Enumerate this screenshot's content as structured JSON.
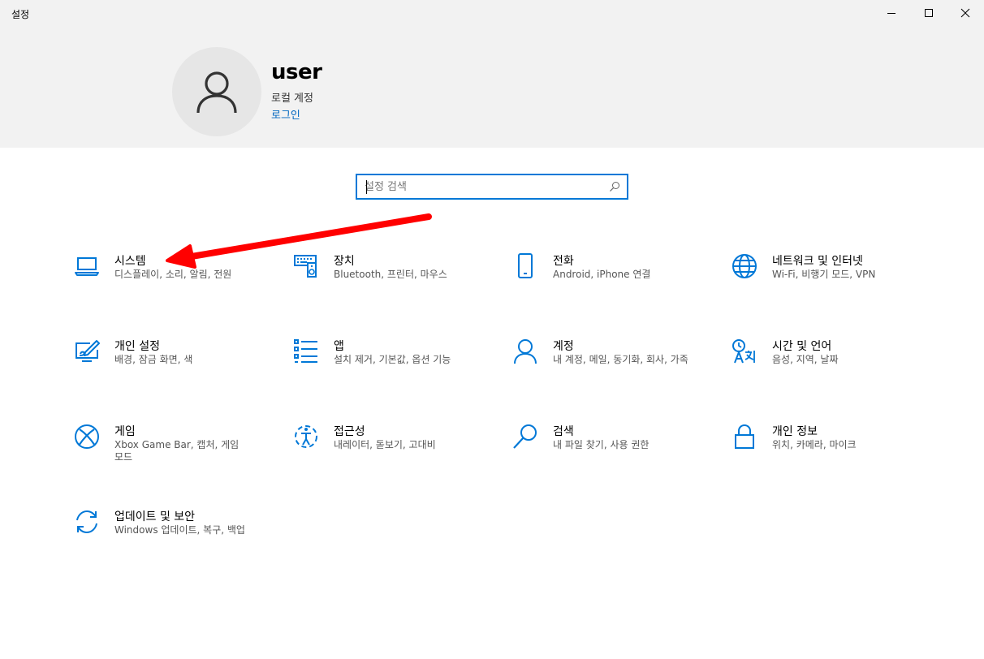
{
  "window": {
    "title": "설정",
    "controls": [
      "minimize-icon",
      "maximize-icon",
      "close-icon"
    ]
  },
  "profile": {
    "username": "user",
    "account_type": "로컬 계정",
    "login_link": "로그인",
    "avatar_icon": "person-icon"
  },
  "search": {
    "placeholder": "설정 검색",
    "value": "",
    "icon": "search-icon"
  },
  "colors": {
    "accent": "#0078d7",
    "link": "#0067c0",
    "header_bg": "#f2f2f2",
    "annotation_arrow": "#ff0000"
  },
  "categories": [
    {
      "icon": "laptop-icon",
      "title": "시스템",
      "desc": "디스플레이, 소리, 알림, 전원"
    },
    {
      "icon": "keyboard-speaker-icon",
      "title": "장치",
      "desc": "Bluetooth, 프린터, 마우스"
    },
    {
      "icon": "phone-icon",
      "title": "전화",
      "desc": "Android, iPhone 연결"
    },
    {
      "icon": "globe-icon",
      "title": "네트워크 및 인터넷",
      "desc": "Wi-Fi, 비행기 모드, VPN"
    },
    {
      "icon": "paint-brush-icon",
      "title": "개인 설정",
      "desc": "배경, 잠금 화면, 색"
    },
    {
      "icon": "app-list-icon",
      "title": "앱",
      "desc": "설치 제거, 기본값, 옵션 기능"
    },
    {
      "icon": "person-icon",
      "title": "계정",
      "desc": "내 계정, 메일, 동기화, 회사, 가족"
    },
    {
      "icon": "language-icon",
      "title": "시간 및 언어",
      "desc": "음성, 지역, 날짜"
    },
    {
      "icon": "xbox-icon",
      "title": "게임",
      "desc": "Xbox Game Bar, 캡처, 게임 모드"
    },
    {
      "icon": "ease-of-access-icon",
      "title": "접근성",
      "desc": "내레이터, 돋보기, 고대비"
    },
    {
      "icon": "search-icon",
      "title": "검색",
      "desc": "내 파일 찾기, 사용 권한"
    },
    {
      "icon": "lock-icon",
      "title": "개인 정보",
      "desc": "위치, 카메라, 마이크"
    },
    {
      "icon": "sync-icon",
      "title": "업데이트 및 보안",
      "desc": "Windows 업데이트, 복구, 백업"
    }
  ]
}
